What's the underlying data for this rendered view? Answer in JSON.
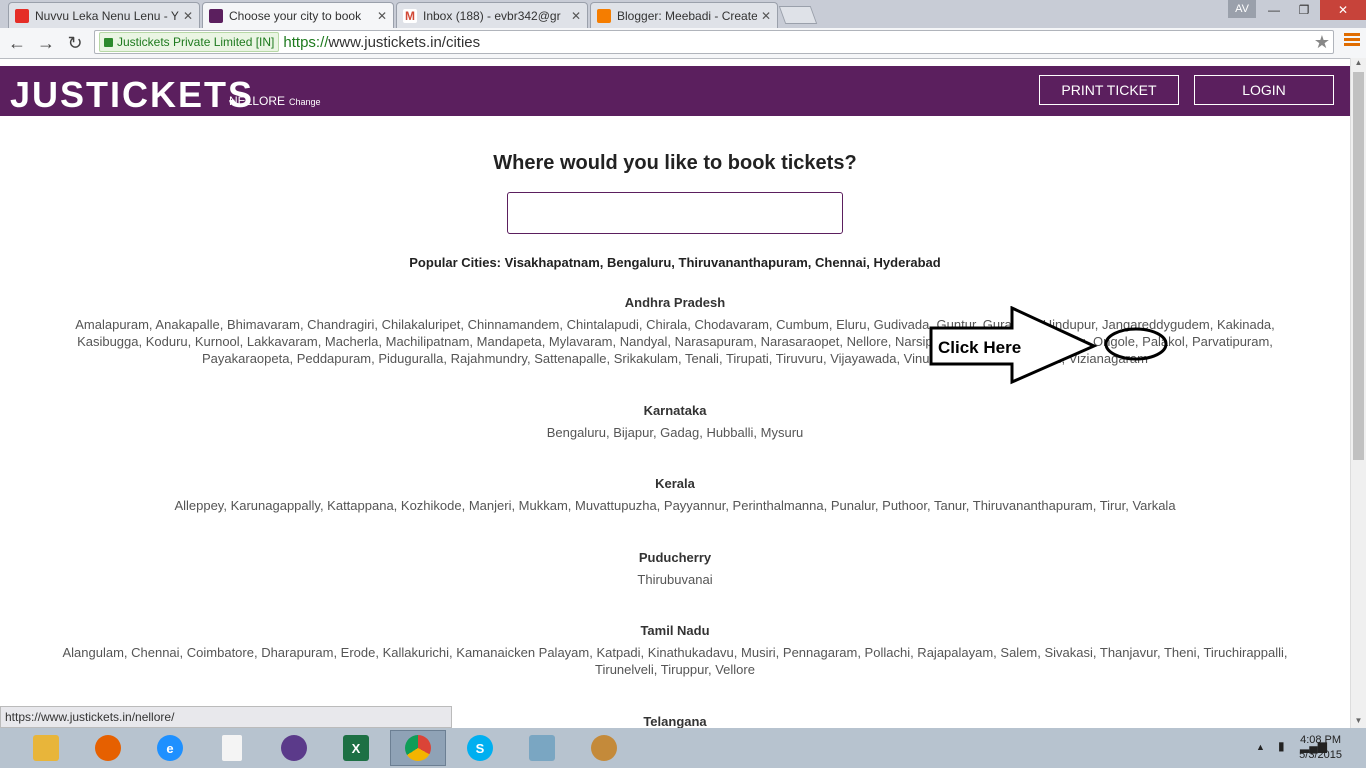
{
  "browser": {
    "tabs": [
      {
        "title": "Nuvvu Leka Nenu Lenu - Y",
        "favicon": "youtube-icon",
        "color": "#e52d27"
      },
      {
        "title": "Choose your city to book",
        "favicon": "justickets-icon",
        "color": "#5b1f5e"
      },
      {
        "title": "Inbox (188) - evbr342@gr",
        "favicon": "gmail-icon",
        "color": "#d14836"
      },
      {
        "title": "Blogger: Meebadi - Create",
        "favicon": "blogger-icon",
        "color": "#f57d00"
      }
    ],
    "profile": "AV",
    "ev_cert": "Justickets Private Limited [IN]",
    "url_scheme": "https://",
    "url_rest": "www.justickets.in/cities",
    "status_url": "https://www.justickets.in/nellore/"
  },
  "site": {
    "logo": "JUSTICKETS",
    "city": "NELLORE",
    "change": "Change",
    "print_ticket": "PRINT TICKET",
    "login": "LOGIN",
    "brand_color": "#5b1f5e"
  },
  "main": {
    "heading": "Where would you like to book tickets?",
    "search_value": "",
    "popular_label": "Popular Cities:",
    "popular_cities": "Visakhapatnam, Bengaluru, Thiruvananthapuram, Chennai, Hyderabad",
    "states": [
      {
        "name": "Andhra Pradesh",
        "cities": "Amalapuram, Anakapalle, Bhimavaram, Chandragiri, Chilakaluripet, Chinnamandem, Chintalapudi, Chirala, Chodavaram, Cumbum, Eluru, Gudivada, Guntur, Gurazala, Hindupur, Jangareddygudem, Kakinada, Kasibugga, Koduru, Kurnool, Lakkavaram, Macherla, Machilipatnam, Mandapeta, Mylavaram, Nandyal, Narasapuram, Narasaraopet, Nellore, Narsipatnam, Nellore, Nuziveedu, Ongole, Palakol, Parvatipuram, Payakaraopeta, Peddapuram, Piduguralla, Rajahmundry, Sattenapalle, Srikakulam, Tenali, Tirupati, Tiruvuru, Vijayawada, Vinukonda, Visakhapatnam, Vizianagaram"
      },
      {
        "name": "Karnataka",
        "cities": "Bengaluru, Bijapur, Gadag, Hubballi, Mysuru"
      },
      {
        "name": "Kerala",
        "cities": "Alleppey, Karunagappally, Kattappana, Kozhikode, Manjeri, Mukkam, Muvattupuzha, Payyannur, Perinthalmanna, Punalur, Puthoor, Tanur, Thiruvananthapuram, Tirur, Varkala"
      },
      {
        "name": "Puducherry",
        "cities": "Thirubuvanai"
      },
      {
        "name": "Tamil Nadu",
        "cities": "Alangulam, Chennai, Coimbatore, Dharapuram, Erode, Kallakurichi, Kamanaicken Palayam, Katpadi, Kinathukadavu, Musiri, Pennagaram, Pollachi, Rajapalayam, Salem, Sivakasi, Thanjavur, Theni, Tiruchirappalli, Tirunelveli, Tiruppur, Vellore"
      },
      {
        "name": "Telangana",
        "cities": ""
      }
    ],
    "annotation": "Click Here"
  },
  "taskbar": {
    "apps": [
      {
        "name": "file-explorer-icon",
        "color": "#e8b53a",
        "glyph": "▬"
      },
      {
        "name": "firefox-icon",
        "color": "#e66000",
        "glyph": "●"
      },
      {
        "name": "internet-explorer-icon",
        "color": "#1e90ff",
        "glyph": "e"
      },
      {
        "name": "document-icon",
        "color": "#f4f4f4",
        "glyph": ""
      },
      {
        "name": "media-player-icon",
        "color": "#5b3a8a",
        "glyph": "◔"
      },
      {
        "name": "excel-icon",
        "color": "#1d7044",
        "glyph": "X"
      },
      {
        "name": "chrome-icon",
        "color": "#db4437",
        "glyph": "◉"
      },
      {
        "name": "skype-icon",
        "color": "#00aff0",
        "glyph": "S"
      },
      {
        "name": "notebook-icon",
        "color": "#7aa6c2",
        "glyph": "▰"
      },
      {
        "name": "paint-icon",
        "color": "#c48a3a",
        "glyph": "✎"
      }
    ],
    "time": "4:08 PM",
    "date": "5/3/2015"
  }
}
